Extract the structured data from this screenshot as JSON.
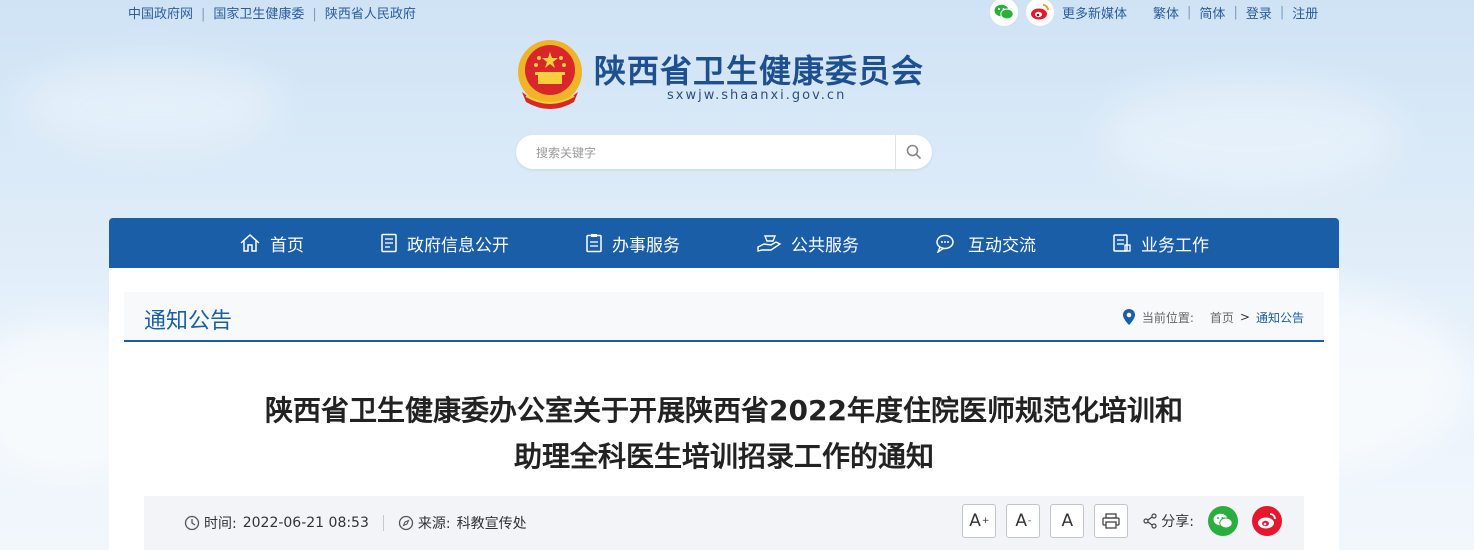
{
  "top_links": [
    "中国政府网",
    "国家卫生健康委",
    "陕西省人民政府"
  ],
  "top_right": {
    "more_media": "更多新媒体",
    "traditional": "繁体",
    "simplified": "简体",
    "login": "登录",
    "register": "注册"
  },
  "site": {
    "title": "陕西省卫生健康委员会",
    "url": "sxwjw.shaanxi.gov.cn"
  },
  "search": {
    "placeholder": "搜索关键字"
  },
  "nav": [
    {
      "label": "首页",
      "icon": "home-icon"
    },
    {
      "label": "政府信息公开",
      "icon": "document-icon"
    },
    {
      "label": "办事服务",
      "icon": "clipboard-icon"
    },
    {
      "label": "公共服务",
      "icon": "hand-service-icon"
    },
    {
      "label": "互动交流",
      "icon": "chat-icon"
    },
    {
      "label": "业务工作",
      "icon": "briefcase-icon"
    }
  ],
  "section": {
    "title": "通知公告",
    "breadcrumb_label": "当前位置:",
    "breadcrumb": [
      "首页",
      "通知公告"
    ]
  },
  "article": {
    "title_line1": "陕西省卫生健康委办公室关于开展陕西省2022年度住院医师规范化培训和",
    "title_line2": "助理全科医生培训招录工作的通知",
    "time_label": "时间:",
    "time_value": "2022-06-21 08:53",
    "source_label": "来源:",
    "source_value": "科教宣传处"
  },
  "tools": {
    "font_large": "A",
    "font_small": "A",
    "font_default": "A",
    "share_label": "分享:"
  },
  "colors": {
    "brand_blue": "#1b5ea8",
    "wechat_green": "#2aae3c",
    "weibo_red": "#e6162d"
  }
}
